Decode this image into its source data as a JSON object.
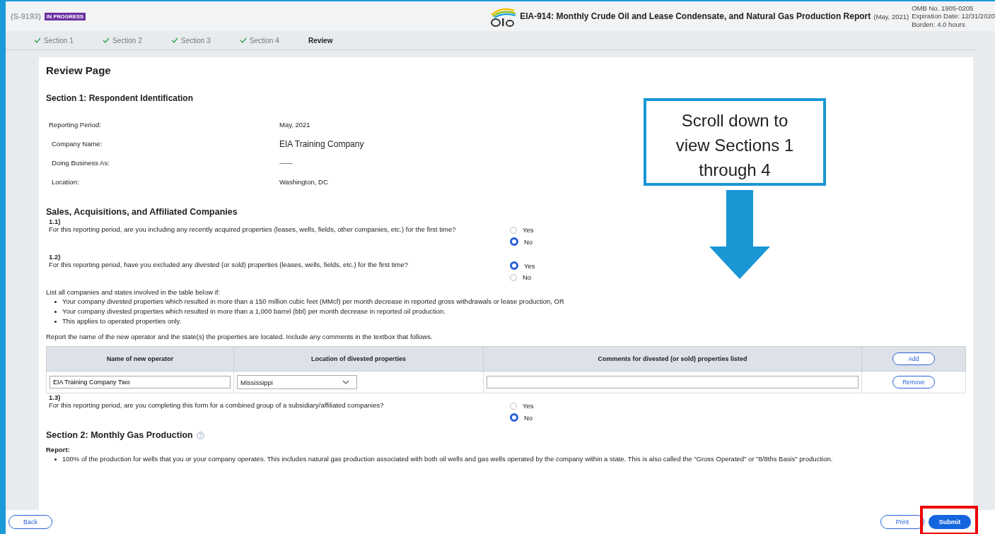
{
  "header": {
    "case_id": "(S-9193)",
    "status": "IN PROGRESS",
    "form_title": "EIA-914: Monthly Crude Oil and Lease Condensate, and Natural Gas Production Report",
    "period": "(May, 2021)",
    "omb": "OMB No. 1905-0205",
    "expiration": "Expiration Date: 12/31/2020",
    "burden": "Burden: 4.0 hours"
  },
  "steps": [
    {
      "label": "Section 1",
      "completed": true,
      "selected": false
    },
    {
      "label": "Section 2",
      "completed": true,
      "selected": false
    },
    {
      "label": "Section 3",
      "completed": true,
      "selected": false
    },
    {
      "label": "Section 4",
      "completed": true,
      "selected": false
    },
    {
      "label": "Review",
      "completed": false,
      "selected": true
    }
  ],
  "page_title": "Review Page",
  "section1_title": "Section 1: Respondent Identification",
  "identification": [
    {
      "label": "Reporting Period:",
      "value": "May, 2021"
    },
    {
      "label": "Company Name:",
      "value": "EIA Training Company"
    },
    {
      "label": "Doing Business As:",
      "value": "------"
    },
    {
      "label": "Location:",
      "value": "Washington, DC"
    }
  ],
  "sales_title": "Sales, Acquisitions, and Affiliated Companies",
  "questions": [
    {
      "number": "1.1)",
      "text": "For this reporting period, are you including any recently acquired properties (leases, wells, fields, other companies, etc.) for the first time?",
      "options": [
        {
          "label": "Yes",
          "selected": false
        },
        {
          "label": "No",
          "selected": true
        }
      ]
    },
    {
      "number": "1.2)",
      "text": "For this reporting period, have you excluded any divested (or sold) properties (leases, wells, fields, etc.) for the first time?",
      "options": [
        {
          "label": "Yes",
          "selected": true
        },
        {
          "label": "No",
          "selected": false
        }
      ]
    }
  ],
  "list_intro": "List all companies and states involved in the table below if:",
  "list_items": [
    "Your company divested properties which resulted in more than a 150 million cubic feet (MMcf) per month decrease in reported gross withdrawals or lease production, OR",
    "Your company divested properties which resulted in more than a 1,000 barrel (bbl) per month decrease in reported oil production.",
    "This applies to operated properties only."
  ],
  "report_instruction": "Report the name of the new operator and the state(s) the properties are located. Include any comments in the textbox that follows.",
  "table": {
    "columns": [
      "Name of new operator",
      "Location of divested properties",
      "Comments for divested (or sold) properties listed"
    ],
    "add_button": "Add",
    "rows": [
      {
        "operator": "EIA Training Company Two",
        "location": "Mississippi",
        "remove_button": "Remove"
      }
    ]
  },
  "question3": {
    "number": "1.3)",
    "text": "For this reporting period, are you completing this form for a combined group of a subsidiary/affiliated companies?",
    "options": [
      {
        "label": "Yes",
        "selected": false
      },
      {
        "label": "No",
        "selected": true
      }
    ]
  },
  "section2_title": "Section 2: Monthly Gas Production",
  "report_label": "Report:",
  "report_items": [
    "100% of the production for wells that you or your company operates. This includes natural gas production associated with both oil wells and gas wells operated by the company within a state. This is also called the \"Gross Operated\" or \"8/8ths Basis\" production."
  ],
  "callout": "Scroll down to view Sections 1 through 4",
  "footer": {
    "back": "Back",
    "print": "Print",
    "submit": "Submit"
  }
}
